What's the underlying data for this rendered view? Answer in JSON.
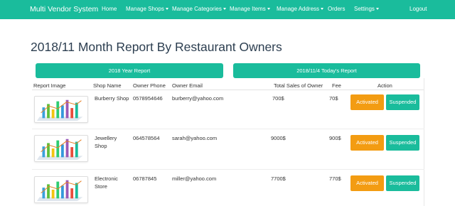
{
  "navbar": {
    "brand": "Multi Vendor System",
    "items": [
      {
        "label": "Home",
        "dropdown": false
      },
      {
        "label": "Manage Shops",
        "dropdown": true
      },
      {
        "label": "Manage Categories",
        "dropdown": true
      },
      {
        "label": "Manage Items",
        "dropdown": true
      },
      {
        "label": "Manage Address",
        "dropdown": true
      },
      {
        "label": "Orders",
        "dropdown": false
      },
      {
        "label": "Settings",
        "dropdown": true
      },
      {
        "label": "Logout",
        "dropdown": false
      }
    ]
  },
  "page": {
    "title": "2018/11 Month Report By Restaurant Owners",
    "year_report_label": "2018 Year Report",
    "today_report_label": "2018/11/4 Today's Report"
  },
  "table": {
    "headers": {
      "report_image": "Report Image",
      "shop_name": "Shop Name",
      "owner_phone": "Owner Phone",
      "owner_email": "Owner Email",
      "total_sales": "Total Sales of Owner",
      "fee": "Fee",
      "action": "Action"
    },
    "rows": [
      {
        "shop_name": "Burberry Shop",
        "owner_phone": "0578954646",
        "owner_email": "burberry@yahoo.com",
        "total_sales": "700$",
        "fee": "70$",
        "activated_label": "Activated",
        "suspended_label": "Suspended"
      },
      {
        "shop_name": "Jewellery Shop",
        "owner_phone": "064578564",
        "owner_email": "sarah@yahoo.com",
        "total_sales": "9000$",
        "fee": "900$",
        "activated_label": "Activated",
        "suspended_label": "Suspended"
      },
      {
        "shop_name": "Electronic Store",
        "owner_phone": "06787845",
        "owner_email": "miller@yahoo.com",
        "total_sales": "7700$",
        "fee": "770$",
        "activated_label": "Activated",
        "suspended_label": "Suspended"
      }
    ]
  },
  "colors": {
    "primary": "#1abc9c",
    "warning": "#f39c12",
    "title": "#2c3e50"
  }
}
